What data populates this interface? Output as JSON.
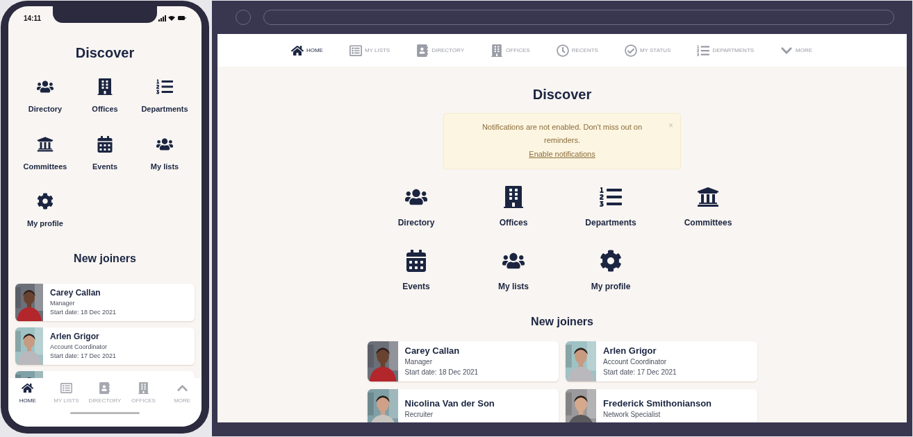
{
  "phone": {
    "status_bar": {
      "time": "14:11"
    },
    "title": "Discover",
    "tiles": [
      {
        "kind": "users",
        "label": "Directory"
      },
      {
        "kind": "building",
        "label": "Offices"
      },
      {
        "kind": "list",
        "label": "Departments"
      },
      {
        "kind": "bank",
        "label": "Committees"
      },
      {
        "kind": "calendar",
        "label": "Events"
      },
      {
        "kind": "users",
        "label": "My lists"
      },
      {
        "kind": "gear",
        "label": "My profile"
      }
    ],
    "section_title": "New joiners",
    "joiners": [
      {
        "name": "Carey Callan",
        "role": "Manager",
        "start": "Start date: 18 Dec 2021",
        "photo": {
          "kind": "picture"
        }
      },
      {
        "name": "Arlen Grigor",
        "role": "Account Coordinator",
        "start": "Start date: 17 Dec 2021",
        "photo": {
          "kind": "picture"
        }
      },
      {
        "photo": {
          "kind": "picture"
        }
      }
    ],
    "tab_bar": [
      {
        "kind": "home",
        "label": "HOME",
        "selected": true
      },
      {
        "kind": "lists",
        "label": "MY LISTS",
        "selected": false
      },
      {
        "kind": "contact",
        "label": "DIRECTORY",
        "selected": false
      },
      {
        "kind": "building",
        "label": "OFFICES",
        "selected": false
      },
      {
        "kind": "up",
        "label": "MORE",
        "selected": false
      }
    ]
  },
  "desktop": {
    "nav": [
      {
        "kind": "home",
        "label": "HOME",
        "selected": true
      },
      {
        "kind": "lists",
        "label": "MY LISTS",
        "selected": false
      },
      {
        "kind": "contact",
        "label": "DIRECTORY",
        "selected": false
      },
      {
        "kind": "building",
        "label": "OFFICES",
        "selected": false
      },
      {
        "kind": "clock",
        "label": "RECENTS",
        "selected": false
      },
      {
        "kind": "check",
        "label": "MY STATUS",
        "selected": false
      },
      {
        "kind": "list",
        "label": "DEPARTMENTS",
        "selected": false
      },
      {
        "kind": "down",
        "label": "MORE",
        "selected": false
      }
    ],
    "title": "Discover",
    "notice": {
      "message": "Notifications are not enabled. Don't miss out on reminders.",
      "link": "Enable notifications",
      "close": "×"
    },
    "tiles": [
      {
        "kind": "users",
        "label": "Directory"
      },
      {
        "kind": "building",
        "label": "Offices"
      },
      {
        "kind": "list",
        "label": "Departments"
      },
      {
        "kind": "bank",
        "label": "Committees"
      },
      {
        "kind": "calendar",
        "label": "Events"
      },
      {
        "kind": "users",
        "label": "My lists"
      },
      {
        "kind": "gear",
        "label": "My profile"
      }
    ],
    "section_title": "New joiners",
    "joiners": [
      {
        "name": "Carey Callan",
        "role": "Manager",
        "start": "Start date: 18 Dec 2021",
        "photo": {
          "kind": "picture"
        }
      },
      {
        "name": "Arlen Grigor",
        "role": "Account Coordinator",
        "start": "Start date: 17 Dec 2021",
        "photo": {
          "kind": "picture"
        }
      },
      {
        "name": "Nicolina Van der Son",
        "role": "Recruiter",
        "photo": {
          "kind": "picture"
        }
      },
      {
        "name": "Frederick Smithonianson",
        "role": "Network Specialist",
        "photo": {
          "kind": "picture"
        }
      }
    ]
  }
}
